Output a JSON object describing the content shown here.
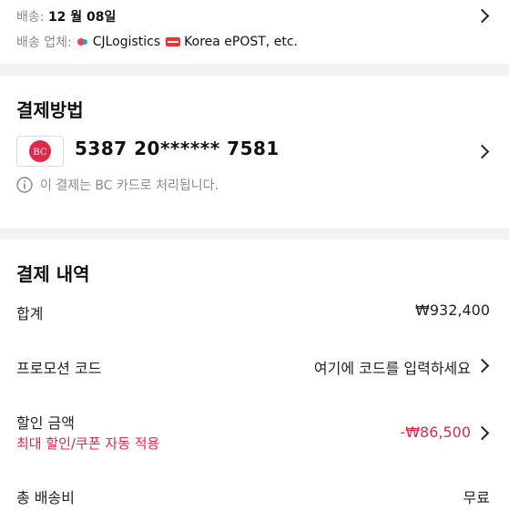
{
  "shipping": {
    "label": "배송:",
    "date": "12 월 08일",
    "carriers_label": "배송 업체:",
    "carriers": [
      {
        "name": "CJLogistics",
        "icon": "cj-logo-icon"
      },
      {
        "name": "Korea ePOST, etc.",
        "icon": "epost-logo-icon"
      }
    ]
  },
  "payment_method": {
    "title": "결제방법",
    "card_number": "5387 20****** 7581",
    "card_icon_text": "BC",
    "notice": "이 결제는 BC 카드로 처리됩니다."
  },
  "payment_details": {
    "title": "결제 내역",
    "subtotal_label": "합계",
    "subtotal_value": "₩932,400",
    "promo_label": "프로모션 코드",
    "promo_placeholder": "여기에 코드를 입력하세요",
    "discount_label": "할인 금액",
    "discount_sub": "최대 할인/쿠폰 자동 적용",
    "discount_value": "-₩86,500",
    "shipping_label": "총 배송비",
    "shipping_value": "무료"
  },
  "colors": {
    "accent": "#e0284a",
    "background": "#f2f2f2"
  }
}
